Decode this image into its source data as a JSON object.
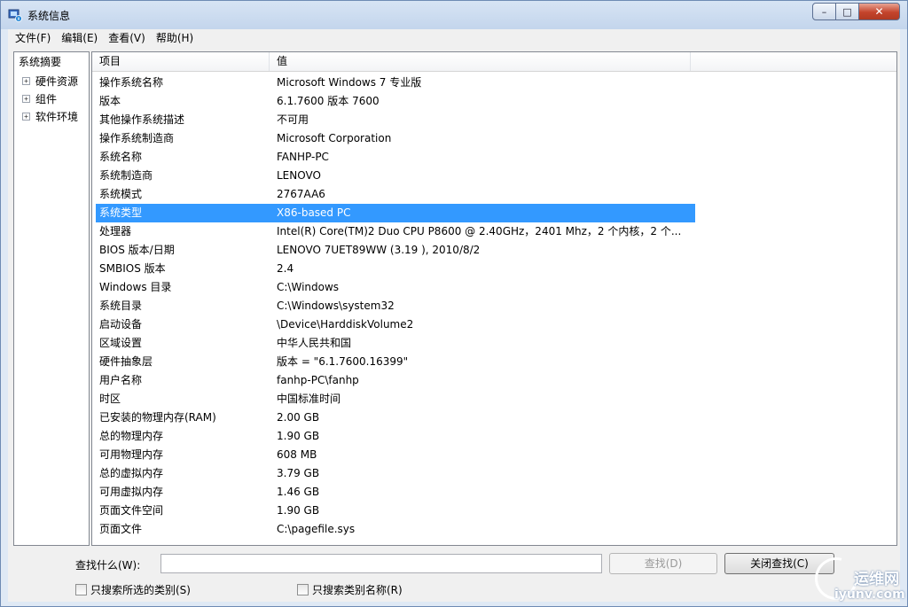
{
  "window": {
    "title": "系统信息",
    "controls": {
      "minimize": "–",
      "maximize": "□",
      "close": "✕"
    }
  },
  "menu": [
    "文件(F)",
    "编辑(E)",
    "查看(V)",
    "帮助(H)"
  ],
  "tree": {
    "root": "系统摘要",
    "children": [
      "硬件资源",
      "组件",
      "软件环境"
    ],
    "expander": "+"
  },
  "list": {
    "columns": [
      "项目",
      "值"
    ],
    "rows": [
      {
        "k": "操作系统名称",
        "v": "Microsoft Windows 7 专业版"
      },
      {
        "k": "版本",
        "v": "6.1.7600 版本 7600"
      },
      {
        "k": "其他操作系统描述",
        "v": "不可用"
      },
      {
        "k": "操作系统制造商",
        "v": "Microsoft Corporation"
      },
      {
        "k": "系统名称",
        "v": "FANHP-PC"
      },
      {
        "k": "系统制造商",
        "v": "LENOVO"
      },
      {
        "k": "系统模式",
        "v": "2767AA6"
      },
      {
        "k": "系统类型",
        "v": "X86-based PC"
      },
      {
        "k": "处理器",
        "v": "Intel(R) Core(TM)2 Duo CPU     P8600  @ 2.40GHz，2401 Mhz，2 个内核，2 个..."
      },
      {
        "k": "BIOS 版本/日期",
        "v": "LENOVO 7UET89WW (3.19 ), 2010/8/2"
      },
      {
        "k": "SMBIOS 版本",
        "v": "2.4"
      },
      {
        "k": "Windows 目录",
        "v": "C:\\Windows"
      },
      {
        "k": "系统目录",
        "v": "C:\\Windows\\system32"
      },
      {
        "k": "启动设备",
        "v": "\\Device\\HarddiskVolume2"
      },
      {
        "k": "区域设置",
        "v": "中华人民共和国"
      },
      {
        "k": "硬件抽象层",
        "v": "版本 = \"6.1.7600.16399\""
      },
      {
        "k": "用户名称",
        "v": "fanhp-PC\\fanhp"
      },
      {
        "k": "时区",
        "v": "中国标准时间"
      },
      {
        "k": "已安装的物理内存(RAM)",
        "v": "2.00 GB"
      },
      {
        "k": "总的物理内存",
        "v": "1.90 GB"
      },
      {
        "k": "可用物理内存",
        "v": "608 MB"
      },
      {
        "k": "总的虚拟内存",
        "v": "3.79 GB"
      },
      {
        "k": "可用虚拟内存",
        "v": "1.46 GB"
      },
      {
        "k": "页面文件空间",
        "v": "1.90 GB"
      },
      {
        "k": "页面文件",
        "v": "C:\\pagefile.sys"
      }
    ],
    "selected_index": 7
  },
  "find": {
    "label": "查找什么(W):",
    "value": "",
    "find_button": "查找(D)",
    "close_button": "关闭查找(C)",
    "check_selected": "只搜索所选的类别(S)",
    "check_names": "只搜索类别名称(R)"
  },
  "watermark": {
    "cn": "运维网",
    "url": "iyunv.com"
  },
  "colors": {
    "selection": "#3399ff",
    "titlebar": "#c3d5ec"
  }
}
